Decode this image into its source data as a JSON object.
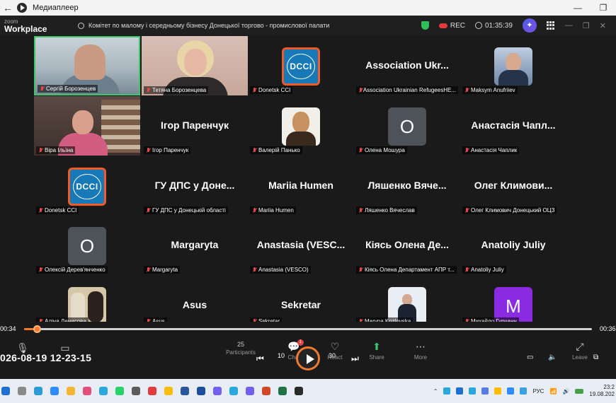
{
  "player": {
    "title": "Медиаплеер",
    "back_glyph": "←",
    "minimize": "—",
    "maximize": "❐"
  },
  "zoom": {
    "brand_small": "zoom",
    "brand_big": "Workplace",
    "meeting_title": "Комітет по малому і середньому бізнесу  Донецької торгово - промислової палати",
    "rec_label": "REC",
    "timer": "01:35:39",
    "accent_green": "#3fc46c",
    "accent_orange": "#f07a2d"
  },
  "participants": [
    {
      "name": "Сергій Борозенцев",
      "type": "video1"
    },
    {
      "name": "Тетяна Борозенцева",
      "type": "video2"
    },
    {
      "name": "Donetsk CCI",
      "type": "dcci",
      "logo_text": "DCCI"
    },
    {
      "name": "Association Ukrainian RefugeesHE...",
      "type": "text",
      "display": "Association  Ukr..."
    },
    {
      "name": "Maksym Anufriiev",
      "type": "pic-man1"
    },
    {
      "name": "Віра Ільїна",
      "type": "video3"
    },
    {
      "name": "Ігор Паренчук",
      "type": "text",
      "display": "Ігор Паренчук"
    },
    {
      "name": "Валерій Панько",
      "type": "pic-man2"
    },
    {
      "name": "Олена Мошура",
      "type": "letter",
      "letter": "O"
    },
    {
      "name": "Анастасія Чаплик",
      "type": "text",
      "display": "Анастасія  Чапл..."
    },
    {
      "name": "Donetsk CCI",
      "type": "dcci",
      "logo_text": "DCCI"
    },
    {
      "name": "ГУ ДПС у Донецькій області",
      "type": "text",
      "display": "ГУ ДПС у Доне..."
    },
    {
      "name": "Mariia Humen",
      "type": "text",
      "display": "Mariia Humen"
    },
    {
      "name": "Ляшенко Вячеслав",
      "type": "text",
      "display": "Ляшенко  Вяче..."
    },
    {
      "name": "Олег Климович Донецький ОЦЗ",
      "type": "text",
      "display": "Олег  Климови..."
    },
    {
      "name": "Олексій Дерев'янченко",
      "type": "letter",
      "letter": "O"
    },
    {
      "name": "Margaryta",
      "type": "text",
      "display": "Margaryta"
    },
    {
      "name": "Anastasia (VESCO)",
      "type": "text",
      "display": "Anastasia  (VESC..."
    },
    {
      "name": "Кіясь Олена Департамент АПР т...",
      "type": "text",
      "display": "Кіясь Олена Де..."
    },
    {
      "name": "Anatoliy Juliy",
      "type": "text",
      "display": "Anatoliy Juliy"
    },
    {
      "name": "Аліна Денисова",
      "type": "pic-women"
    },
    {
      "name": "Asus",
      "type": "text",
      "display": "Asus"
    },
    {
      "name": "Sekretar",
      "type": "text",
      "display": "Sekretar"
    },
    {
      "name": "Maryna Kozlovska",
      "type": "pic-maryna"
    },
    {
      "name": "Михайло Гурчанн",
      "type": "letter-purple",
      "letter": "M"
    }
  ],
  "timeline": {
    "elapsed": "00:34",
    "total": "00:36",
    "progress_fraction": 0.023
  },
  "toolbar": {
    "datetime": "026-08-19 12-23-15",
    "participants_count": "25",
    "participants_label": "Participants",
    "chat_label": "Chat",
    "react_label": "React",
    "share_label": "Share",
    "more_label": "More",
    "leave_label": "Leave",
    "skip_back": "10",
    "skip_fwd": "30",
    "chat_badge": "1"
  },
  "taskbar": {
    "lang": "РУС",
    "time": "23:2",
    "date": "19.08.202"
  }
}
